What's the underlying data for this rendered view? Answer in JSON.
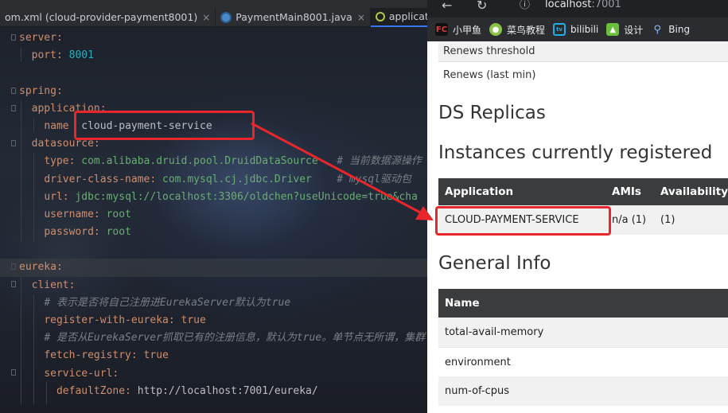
{
  "ide": {
    "tabs": [
      {
        "label": "om.xml (cloud-provider-payment8001)",
        "active": false
      },
      {
        "label": "PaymentMain8001.java",
        "active": false
      },
      {
        "label": "application.yml",
        "active": true
      }
    ],
    "tab_close": "×",
    "code": {
      "server_key": "server:",
      "port_key": "port:",
      "port_val": "8001",
      "spring_key": "spring:",
      "application_key": "application:",
      "name_key": "name",
      "name_val": "cloud-payment-service",
      "datasource_key": "datasource:",
      "type_key": "type:",
      "type_val": "com.alibaba.druid.pool.DruidDataSource",
      "type_comment": "# 当前数据源操作",
      "driver_key": "driver-class-name:",
      "driver_val": "com.mysql.cj.jdbc.Driver",
      "driver_comment": "# mysql驱动包",
      "url_key": "url:",
      "url_val": "jdbc:mysql://localhost:3306/oldchen?useUnicode=true&cha",
      "username_key": "username:",
      "username_val": "root",
      "password_key": "password:",
      "password_val": "root",
      "eureka_key": "eureka:",
      "client_key": "client:",
      "comment_register": "# 表示是否将自己注册进EurekaServer默认为true",
      "register_key": "register-with-eureka:",
      "register_val": "true",
      "comment_fetch": "# 是否从EurekaServer抓取已有的注册信息，默认为true。单节点无所谓，集群",
      "fetch_key": "fetch-registry:",
      "fetch_val": "true",
      "service_url_key": "service-url:",
      "default_zone_key": "defaultZone:",
      "default_zone_val": "http://localhost:7001/eureka/"
    }
  },
  "browser": {
    "back_icon": "back-arrow-icon",
    "reload_icon": "reload-icon",
    "info_icon": "info-icon",
    "url_host": "localhost",
    "url_port": ":7001",
    "bookmarks": [
      {
        "label": "小甲鱼",
        "icon": "FC",
        "icon_bg": "#111111",
        "icon_fg": "#e53935"
      },
      {
        "label": "菜鸟教程",
        "icon": "●",
        "icon_bg": "#8bc34a",
        "icon_fg": "#ffffff"
      },
      {
        "label": "bilibili",
        "icon": "tv",
        "icon_bg": "#2b2c30",
        "icon_fg": "#23ade5"
      },
      {
        "label": "设计",
        "icon": "▲",
        "icon_bg": "#6bbf3a",
        "icon_fg": "#ffffff"
      },
      {
        "label": "Bing",
        "icon": "⚲",
        "icon_bg": "#2b2c30",
        "icon_fg": "#8ab4f8"
      }
    ],
    "renews_threshold": "Renews threshold",
    "renews_last_min": "Renews (last min)",
    "ds_replicas": "DS Replicas",
    "instances_title": "Instances currently registered",
    "instances_headers": [
      "Application",
      "AMIs",
      "Availability Z"
    ],
    "instance_row": {
      "application": "CLOUD-PAYMENT-SERVICE",
      "amis": "n/a (1)",
      "availability": "(1)"
    },
    "general_info": "General Info",
    "general_header": "Name",
    "general_rows": [
      "total-avail-memory",
      "environment",
      "num-of-cpus"
    ]
  },
  "colors": {
    "annotation_red": "#e8262b",
    "yaml_key": "#cf8e6d",
    "yaml_string": "#6aab73",
    "yaml_number": "#2aacb8",
    "eureka_table_header": "#3a3c3e"
  }
}
